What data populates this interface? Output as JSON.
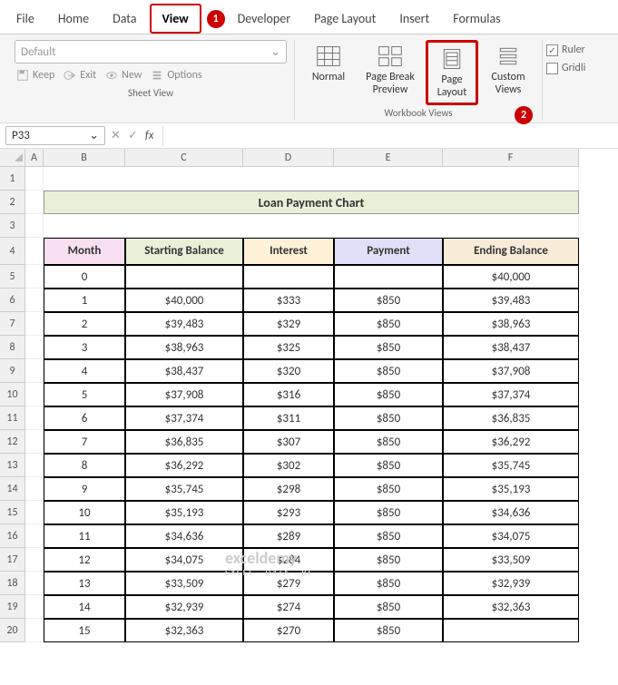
{
  "tabs": [
    "File",
    "Home",
    "Data",
    "View",
    "Developer",
    "Page Layout",
    "Insert",
    "Formulas"
  ],
  "active_tab": "View",
  "callouts": {
    "tab": "1",
    "page_layout": "2"
  },
  "sheet_view": {
    "combo": "Default",
    "buttons": {
      "keep": "Keep",
      "exit": "Exit",
      "new": "New",
      "options": "Options"
    },
    "label": "Sheet View"
  },
  "workbook_views": {
    "normal": "Normal",
    "page_break": "Page Break Preview",
    "page_layout": "Page Layout",
    "custom": "Custom Views",
    "label": "Workbook Views"
  },
  "show": {
    "ruler": "Ruler",
    "gridlines": "Gridli"
  },
  "namebox": "P33",
  "col_headers": [
    "A",
    "B",
    "C",
    "D",
    "E",
    "F"
  ],
  "row_headers": [
    "1",
    "2",
    "3",
    "4",
    "5",
    "6",
    "7",
    "8",
    "9",
    "10",
    "11",
    "12",
    "13",
    "14",
    "15",
    "16",
    "17",
    "18",
    "19",
    "20"
  ],
  "title": "Loan Payment Chart",
  "headers": {
    "month": "Month",
    "start": "Starting Balance",
    "interest": "Interest",
    "payment": "Payment",
    "ending": "Ending Balance"
  },
  "chart_data": {
    "type": "table",
    "title": "Loan Payment Chart",
    "columns": [
      "Month",
      "Starting Balance",
      "Interest",
      "Payment",
      "Ending Balance"
    ],
    "rows": [
      {
        "month": "0",
        "start": "",
        "interest": "",
        "payment": "",
        "ending": "$40,000"
      },
      {
        "month": "1",
        "start": "$40,000",
        "interest": "$333",
        "payment": "$850",
        "ending": "$39,483"
      },
      {
        "month": "2",
        "start": "$39,483",
        "interest": "$329",
        "payment": "$850",
        "ending": "$38,963"
      },
      {
        "month": "3",
        "start": "$38,963",
        "interest": "$325",
        "payment": "$850",
        "ending": "$38,437"
      },
      {
        "month": "4",
        "start": "$38,437",
        "interest": "$320",
        "payment": "$850",
        "ending": "$37,908"
      },
      {
        "month": "5",
        "start": "$37,908",
        "interest": "$316",
        "payment": "$850",
        "ending": "$37,374"
      },
      {
        "month": "6",
        "start": "$37,374",
        "interest": "$311",
        "payment": "$850",
        "ending": "$36,835"
      },
      {
        "month": "7",
        "start": "$36,835",
        "interest": "$307",
        "payment": "$850",
        "ending": "$36,292"
      },
      {
        "month": "8",
        "start": "$36,292",
        "interest": "$302",
        "payment": "$850",
        "ending": "$35,745"
      },
      {
        "month": "9",
        "start": "$35,745",
        "interest": "$298",
        "payment": "$850",
        "ending": "$35,193"
      },
      {
        "month": "10",
        "start": "$35,193",
        "interest": "$293",
        "payment": "$850",
        "ending": "$34,636"
      },
      {
        "month": "11",
        "start": "$34,636",
        "interest": "$289",
        "payment": "$850",
        "ending": "$34,075"
      },
      {
        "month": "12",
        "start": "$34,075",
        "interest": "$284",
        "payment": "$850",
        "ending": "$33,509"
      },
      {
        "month": "13",
        "start": "$33,509",
        "interest": "$279",
        "payment": "$850",
        "ending": "$32,939"
      },
      {
        "month": "14",
        "start": "$32,939",
        "interest": "$274",
        "payment": "$850",
        "ending": "$32,363"
      },
      {
        "month": "15",
        "start": "$32,363",
        "interest": "$270",
        "payment": "$850",
        "ending": ""
      }
    ]
  },
  "watermark": {
    "main": "exceldemy",
    "sub": "EXCEL · DATA · BI"
  }
}
